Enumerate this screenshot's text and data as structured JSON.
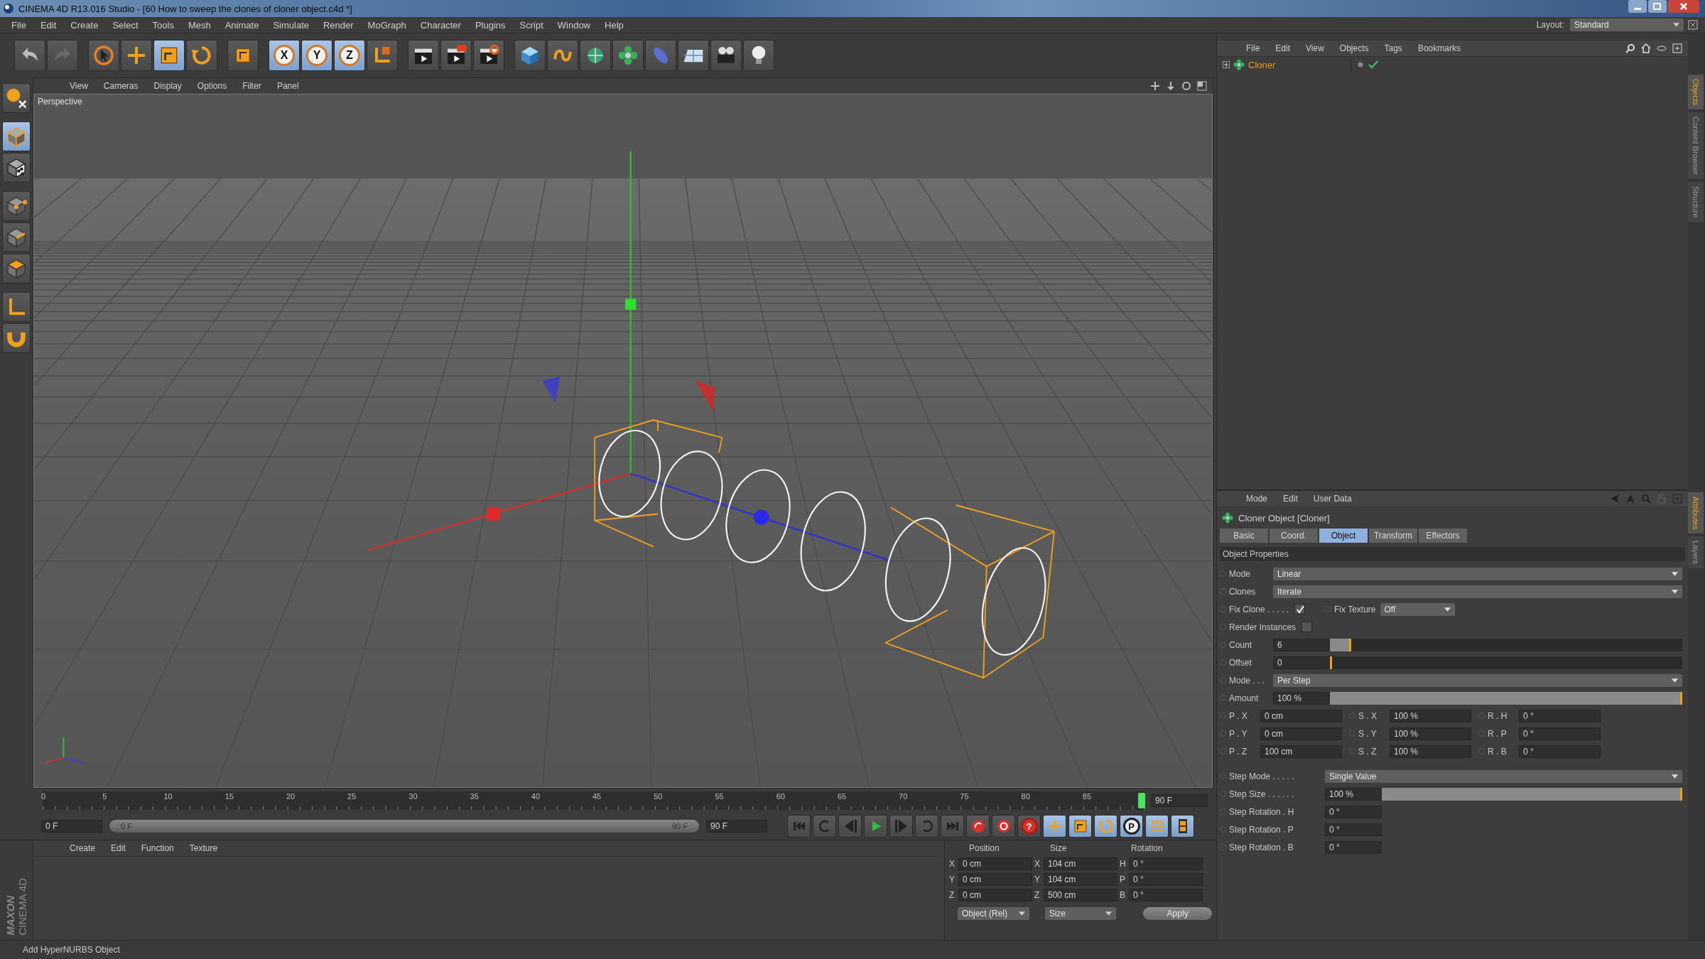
{
  "window": {
    "title": "CINEMA 4D R13.016 Studio - [60 How to sweep the clones of cloner object.c4d *]"
  },
  "menu": [
    "File",
    "Edit",
    "Create",
    "Select",
    "Tools",
    "Mesh",
    "Animate",
    "Simulate",
    "Render",
    "MoGraph",
    "Character",
    "Plugins",
    "Script",
    "Window",
    "Help"
  ],
  "layout": {
    "label": "Layout:",
    "value": "Standard"
  },
  "toolbar": [
    {
      "tools": [
        {
          "kind": "undo",
          "selected": false
        },
        {
          "kind": "redo",
          "selected": false
        }
      ]
    },
    {
      "tools": [
        {
          "kind": "select",
          "selected": false
        },
        {
          "kind": "move",
          "selected": false
        },
        {
          "kind": "scale",
          "selected": true
        },
        {
          "kind": "rotate",
          "selected": false
        }
      ]
    },
    {
      "tools": [
        {
          "kind": "recent",
          "selected": false
        }
      ]
    },
    {
      "tools": [
        {
          "kind": "axis",
          "label": "X",
          "selected": true
        },
        {
          "kind": "axis",
          "label": "Y",
          "selected": true
        },
        {
          "kind": "axis",
          "label": "Z",
          "selected": true
        },
        {
          "kind": "coord",
          "selected": false
        }
      ]
    },
    {
      "tools": [
        {
          "kind": "render-view",
          "selected": false
        },
        {
          "kind": "render-pic",
          "selected": false
        },
        {
          "kind": "render-settings",
          "selected": false
        }
      ]
    },
    {
      "tools": [
        {
          "kind": "cube",
          "selected": false
        },
        {
          "kind": "spline",
          "selected": false
        },
        {
          "kind": "nurbs",
          "selected": false
        },
        {
          "kind": "mograph",
          "selected": false
        },
        {
          "kind": "deformer",
          "selected": false
        },
        {
          "kind": "scene",
          "selected": false
        },
        {
          "kind": "camera",
          "selected": false
        },
        {
          "kind": "light",
          "selected": false
        }
      ]
    }
  ],
  "tools_left": [
    {
      "tools": [
        {
          "kind": "mode",
          "selected": false
        }
      ]
    },
    {
      "tools": [
        {
          "kind": "model",
          "selected": true
        },
        {
          "kind": "texture",
          "selected": false
        }
      ]
    },
    {
      "tools": [
        {
          "kind": "points",
          "selected": false
        },
        {
          "kind": "edges",
          "selected": false
        },
        {
          "kind": "polygons",
          "selected": false
        }
      ]
    },
    {
      "tools": [
        {
          "kind": "axis-mode",
          "selected": false
        },
        {
          "kind": "snap",
          "selected": false
        }
      ]
    }
  ],
  "viewport": {
    "menu": [
      "View",
      "Cameras",
      "Display",
      "Options",
      "Filter",
      "Panel"
    ],
    "camera": "Perspective"
  },
  "timeline": {
    "ticks": [
      "0",
      "5",
      "10",
      "15",
      "20",
      "25",
      "30",
      "35",
      "40",
      "45",
      "50",
      "55",
      "60",
      "65",
      "70",
      "75",
      "80",
      "85"
    ],
    "level": 1,
    "end_field": "90 F"
  },
  "transport": {
    "start_field": "0 F",
    "range": {
      "start": "0 F",
      "end": "90 F",
      "level": 1
    },
    "end_field": "90 F",
    "buttons": [
      {
        "kind": "start",
        "selected": false
      },
      {
        "kind": "loop-back",
        "selected": false
      },
      {
        "kind": "prev",
        "selected": false
      },
      {
        "kind": "play",
        "selected": false
      },
      {
        "kind": "next",
        "selected": false
      },
      {
        "kind": "loop",
        "selected": false
      },
      {
        "kind": "end",
        "selected": false
      },
      {
        "kind": "record",
        "selected": false
      },
      {
        "kind": "autokey",
        "selected": false
      },
      {
        "kind": "key-help",
        "label": "?",
        "selected": false
      },
      {
        "kind": "key-move",
        "selected": true
      },
      {
        "kind": "key-scale",
        "selected": true
      },
      {
        "kind": "key-rotate",
        "selected": true
      },
      {
        "kind": "key-pla",
        "label": "P",
        "selected": true
      },
      {
        "kind": "key-grid",
        "selected": true
      },
      {
        "kind": "film",
        "selected": true
      }
    ]
  },
  "materials": {
    "menu": [
      "Create",
      "Edit",
      "Function",
      "Texture"
    ]
  },
  "logo": {
    "brand": "MAXON",
    "product": "CINEMA 4D"
  },
  "coordinates": {
    "headers": [
      "Position",
      "Size",
      "Rotation"
    ],
    "rows": [
      {
        "cells": [
          {
            "axis": "X",
            "value": "0 cm"
          },
          {
            "axis": "X",
            "value": "104 cm"
          },
          {
            "axis": "H",
            "value": "0 °"
          }
        ]
      },
      {
        "cells": [
          {
            "axis": "Y",
            "value": "0 cm"
          },
          {
            "axis": "Y",
            "value": "104 cm"
          },
          {
            "axis": "P",
            "value": "0 °"
          }
        ]
      },
      {
        "cells": [
          {
            "axis": "Z",
            "value": "0 cm"
          },
          {
            "axis": "Z",
            "value": "500 cm"
          },
          {
            "axis": "B",
            "value": "0 °"
          }
        ]
      }
    ],
    "mode": "Object (Rel)",
    "size_mode": "Size",
    "apply": "Apply"
  },
  "status_bar": "Add HyperNURBS Object",
  "objects": {
    "menu": [
      "File",
      "Edit",
      "View",
      "Objects",
      "Tags",
      "Bookmarks"
    ],
    "items": [
      {
        "name": "Cloner",
        "selected": true
      }
    ]
  },
  "attributes": {
    "menu": [
      "Mode",
      "Edit",
      "User Data"
    ],
    "title": "Cloner Object [Cloner]",
    "tabs": [
      {
        "label": "Basic",
        "selected": false
      },
      {
        "label": "Coord.",
        "selected": false
      },
      {
        "label": "Object",
        "selected": true
      },
      {
        "label": "Transform",
        "selected": false
      },
      {
        "label": "Effectors",
        "selected": false
      }
    ],
    "section": "Object Properties",
    "rows": [
      {
        "kind": "dropdown",
        "label": "Mode",
        "value": "Linear"
      },
      {
        "kind": "dropdown",
        "label": "Clones",
        "value": "Iterate"
      },
      {
        "kind": "check-pair",
        "label": "Fix Clone . . . . .",
        "checked": true,
        "label2": "Fix Texture",
        "value": "Off"
      },
      {
        "kind": "checkbox",
        "label": "Render Instances",
        "checked": false
      },
      {
        "kind": "slider",
        "label": "Count",
        "value": "6",
        "level": 0.06
      },
      {
        "kind": "slider",
        "label": "Offset",
        "value": "0",
        "level": 0
      },
      {
        "kind": "dropdown",
        "label": "Mode . . .",
        "value": "Per Step"
      },
      {
        "kind": "slider",
        "label": "Amount",
        "value": "100 %",
        "level": 1
      }
    ],
    "grid": [
      {
        "cells": [
          {
            "label": "P . X",
            "value": "0 cm"
          },
          {
            "label": "S . X",
            "value": "100 %"
          },
          {
            "label": "R . H",
            "value": "0 °"
          }
        ]
      },
      {
        "cells": [
          {
            "label": "P . Y",
            "value": "0 cm"
          },
          {
            "label": "S . Y",
            "value": "100 %"
          },
          {
            "label": "R . P",
            "value": "0 °"
          }
        ]
      },
      {
        "cells": [
          {
            "label": "P . Z",
            "value": "100 cm"
          },
          {
            "label": "S . Z",
            "value": "100 %"
          },
          {
            "label": "R . B",
            "value": "0 °"
          }
        ]
      }
    ],
    "step_rows": [
      {
        "kind": "dropdown",
        "label": "Step Mode . . . . .",
        "value": "Single Value"
      },
      {
        "kind": "slider",
        "label": "Step Size . . . . . .",
        "value": "100 %",
        "level": 1
      },
      {
        "kind": "field",
        "label": "Step Rotation . H",
        "value": "0 °"
      },
      {
        "kind": "field",
        "label": "Step Rotation . P",
        "value": "0 °"
      },
      {
        "kind": "field",
        "label": "Step Rotation . B",
        "value": "0 °"
      }
    ]
  },
  "side_tabs": {
    "top": [
      {
        "label": "Objects",
        "selected": true
      },
      {
        "label": "Content Browser",
        "selected": false
      },
      {
        "label": "Structure",
        "selected": false
      }
    ],
    "bottom": [
      {
        "label": "Attributes",
        "selected": true
      },
      {
        "label": "Layers",
        "selected": false
      }
    ]
  }
}
